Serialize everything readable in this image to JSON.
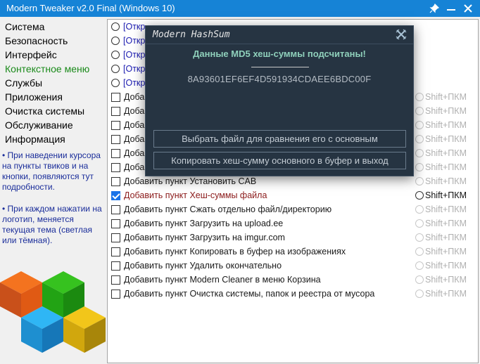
{
  "window": {
    "title": "Modern Tweaker v2.0 Final (Windows 10)",
    "controls": {
      "pin": "pin-icon",
      "minimize": "minimize-icon",
      "close": "close-icon"
    }
  },
  "sidebar": {
    "items": [
      {
        "label": "Система",
        "active": false
      },
      {
        "label": "Безопасность",
        "active": false
      },
      {
        "label": "Интерфейс",
        "active": false
      },
      {
        "label": "Контекстное меню",
        "active": true
      },
      {
        "label": "Службы",
        "active": false
      },
      {
        "label": "Приложения",
        "active": false
      },
      {
        "label": "Очистка системы",
        "active": false
      },
      {
        "label": "Обслуживание",
        "active": false
      },
      {
        "label": "Информация",
        "active": false
      }
    ],
    "hints": [
      "• При наведении курсора на пункты твиков и на кнопки, появляются тут подробности.",
      "• При каждом нажатии на логотип, меняется текущая тема (светлая или тёмная)."
    ],
    "active_color": "#1a8a1a"
  },
  "content": {
    "radio_rows": [
      {
        "label": "[Откр"
      },
      {
        "label": "[Откр"
      },
      {
        "label": "[Откр"
      },
      {
        "label": "[Откр"
      },
      {
        "label": "[Откр"
      }
    ],
    "rows": [
      {
        "label": "Добав",
        "checked": false,
        "shift": "Shift+ПКМ",
        "shift_enabled": false
      },
      {
        "label": "Добав",
        "checked": false,
        "shift": "Shift+ПКМ",
        "shift_enabled": false
      },
      {
        "label": "Добав",
        "checked": false,
        "shift": "Shift+ПКМ",
        "shift_enabled": false
      },
      {
        "label": "Добав",
        "checked": false,
        "shift": "Shift+ПКМ",
        "shift_enabled": false
      },
      {
        "label": "Добав",
        "checked": false,
        "shift": "Shift+ПКМ",
        "shift_enabled": false
      },
      {
        "label": "Добав",
        "checked": false,
        "shift": "Shift+ПКМ",
        "shift_enabled": false
      },
      {
        "label": "Добавить пункт Установить CAB",
        "checked": false,
        "shift": "Shift+ПКМ",
        "shift_enabled": false
      },
      {
        "label": "Добавить пункт Хеш-суммы файла",
        "checked": true,
        "shift": "Shift+ПКМ",
        "shift_enabled": true
      },
      {
        "label": "Добавить пункт Сжать отдельно файл/директорию",
        "checked": false,
        "shift": "Shift+ПКМ",
        "shift_enabled": false
      },
      {
        "label": "Добавить пункт Загрузить на upload.ee",
        "checked": false,
        "shift": "Shift+ПКМ",
        "shift_enabled": false
      },
      {
        "label": "Добавить пункт Загрузить на imgur.com",
        "checked": false,
        "shift": "Shift+ПКМ",
        "shift_enabled": false
      },
      {
        "label": "Добавить пункт Копировать в буфер на изображениях",
        "checked": false,
        "shift": "Shift+ПКМ",
        "shift_enabled": false
      },
      {
        "label": "Добавить пункт Удалить окончательно",
        "checked": false,
        "shift": "Shift+ПКМ",
        "shift_enabled": false
      },
      {
        "label": "Добавить пункт Modern Cleaner в меню Корзина",
        "checked": false,
        "shift": "Shift+ПКМ",
        "shift_enabled": false
      },
      {
        "label": "Добавить пункт Очистка системы, папок и реестра от мусора",
        "checked": false,
        "shift": "Shift+ПКМ",
        "shift_enabled": false
      }
    ]
  },
  "dialog": {
    "title": "Modern HashSum",
    "close_icon": "close-icon",
    "heading": "Данные MD5 хеш-суммы подсчитаны!",
    "hash": "8A93601EF6EF4D591934CDAEE6BDC00F",
    "compare_button": "Выбрать файл для сравнения его с основным",
    "copy_button": "Копировать хеш-сумму основного в буфер и выход",
    "heading_color": "#8fd0bb",
    "background_color": "#263442"
  },
  "logo": {
    "icon": "modern-tweaker-logo-icon"
  },
  "colors": {
    "titlebar": "#1683d6",
    "accent": "#1a73e8"
  }
}
